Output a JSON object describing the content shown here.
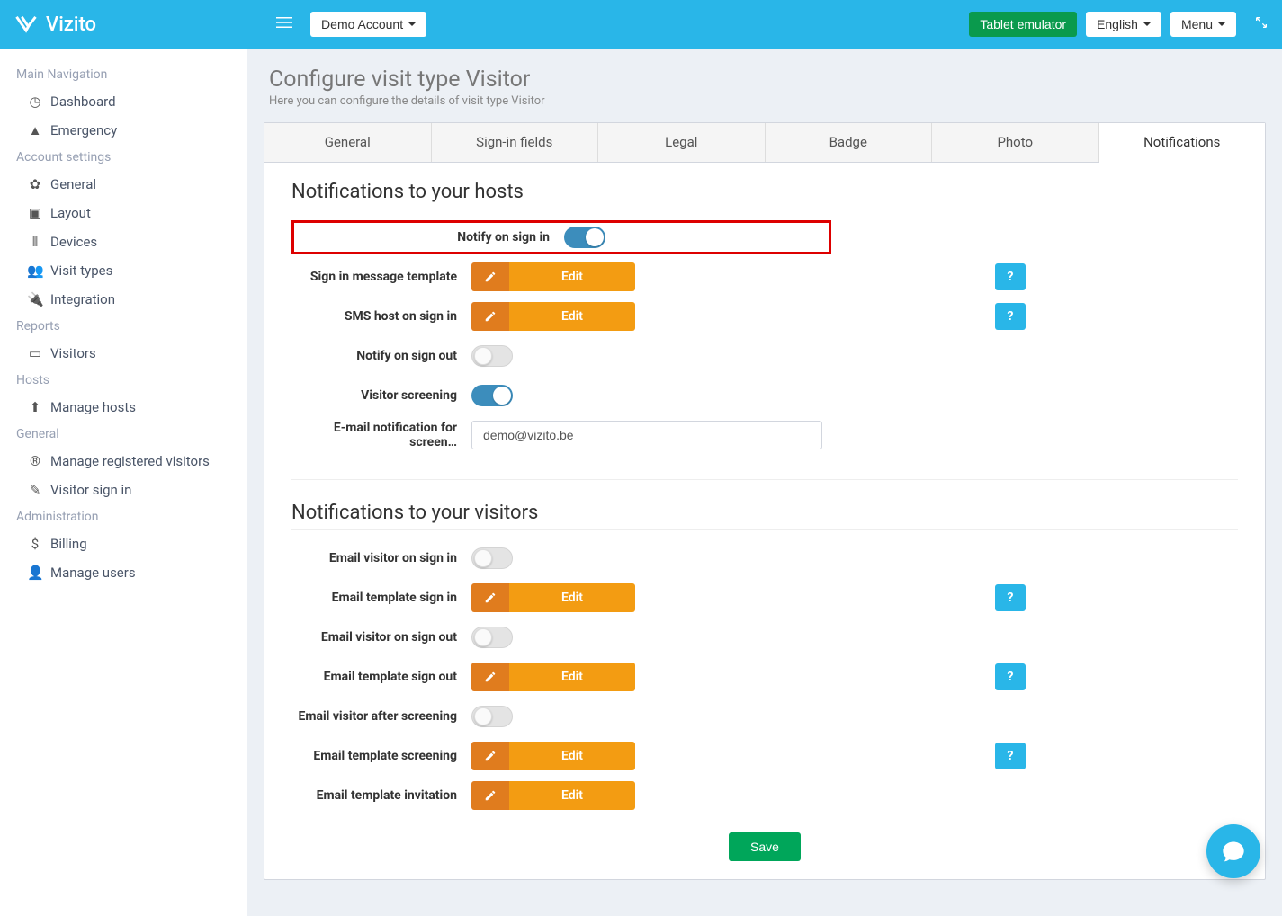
{
  "topbar": {
    "brand": "Vizito",
    "account_label": "Demo Account",
    "tablet_emulator": "Tablet emulator",
    "language": "English",
    "menu": "Menu"
  },
  "sidebar": {
    "sections": {
      "main_nav": "Main Navigation",
      "account_settings": "Account settings",
      "reports": "Reports",
      "hosts": "Hosts",
      "general": "General",
      "administration": "Administration"
    },
    "items": {
      "dashboard": "Dashboard",
      "emergency": "Emergency",
      "general": "General",
      "layout": "Layout",
      "devices": "Devices",
      "visit_types": "Visit types",
      "integration": "Integration",
      "visitors": "Visitors",
      "manage_hosts": "Manage hosts",
      "manage_registered": "Manage registered visitors",
      "visitor_signin": "Visitor sign in",
      "billing": "Billing",
      "manage_users": "Manage users"
    }
  },
  "header": {
    "title": "Configure visit type Visitor",
    "subtitle": "Here you can configure the details of visit type Visitor"
  },
  "tabs": {
    "general": "General",
    "signin_fields": "Sign-in fields",
    "legal": "Legal",
    "badge": "Badge",
    "photo": "Photo",
    "notifications": "Notifications"
  },
  "sections": {
    "hosts_title": "Notifications to your hosts",
    "visitors_title": "Notifications to your visitors"
  },
  "labels": {
    "notify_signin": "Notify on sign in",
    "signin_template": "Sign in message template",
    "sms_host_signin": "SMS host on sign in",
    "notify_signout": "Notify on sign out",
    "visitor_screening": "Visitor screening",
    "email_screening": "E-mail notification for screen…",
    "email_visitor_signin": "Email visitor on sign in",
    "email_template_signin": "Email template sign in",
    "email_visitor_signout": "Email visitor on sign out",
    "email_template_signout": "Email template sign out",
    "email_visitor_after_screening": "Email visitor after screening",
    "email_template_screening": "Email template screening",
    "email_template_invitation": "Email template invitation"
  },
  "values": {
    "screening_email": "demo@vizito.be"
  },
  "buttons": {
    "edit": "Edit",
    "save": "Save",
    "help": "?"
  }
}
